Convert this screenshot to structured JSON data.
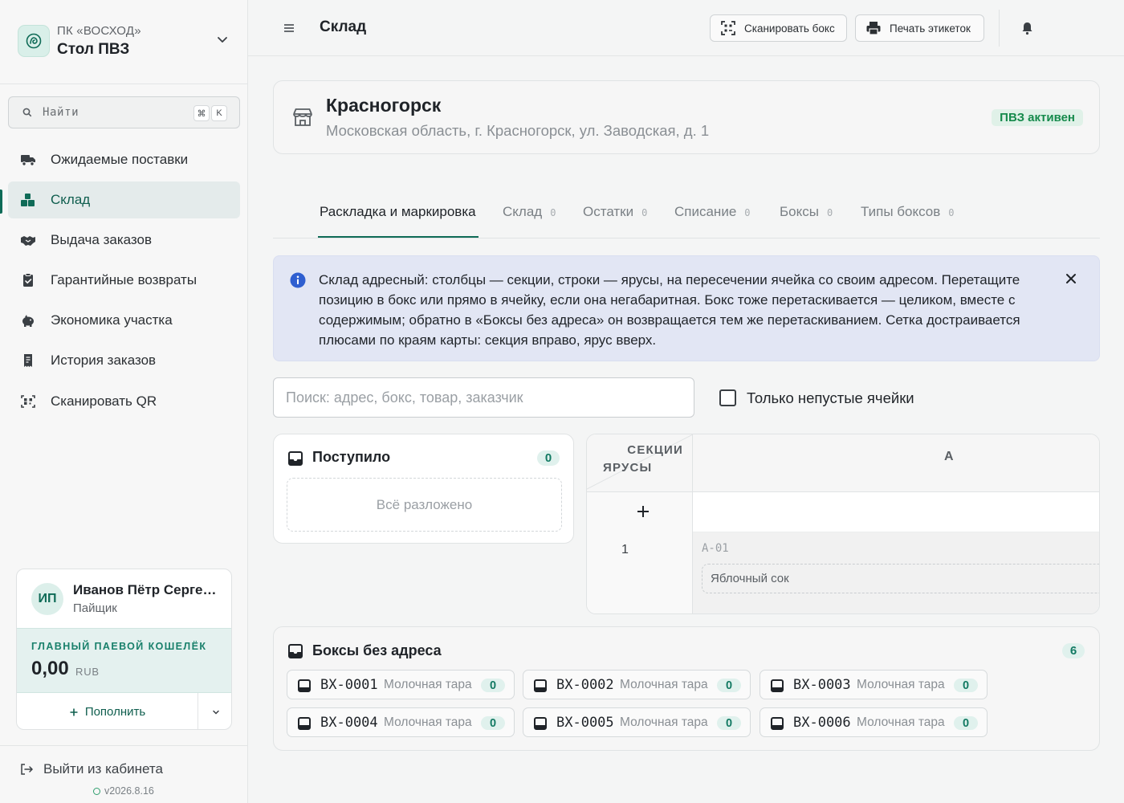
{
  "sidebar": {
    "org": "ПК «ВОСХОД»",
    "name": "Стол ПВЗ",
    "search": {
      "label": "Найти",
      "kbd": [
        "⌘",
        "K"
      ]
    },
    "items": [
      {
        "label": "Ожидаемые поставки",
        "icon": "truck-icon"
      },
      {
        "label": "Склад",
        "icon": "boxes-icon",
        "active": true
      },
      {
        "label": "Выдача заказов",
        "icon": "handshake-icon"
      },
      {
        "label": "Гарантийные возвраты",
        "icon": "clipboard-check-icon"
      },
      {
        "label": "Экономика участка",
        "icon": "piggy-bank-icon"
      },
      {
        "label": "История заказов",
        "icon": "receipt-icon"
      },
      {
        "label": "Сканировать QR",
        "icon": "qr-scan-icon"
      }
    ],
    "user": {
      "initials": "ИП",
      "name": "Иванов Пётр Сергеевич",
      "role": "Пайщик",
      "wallet_title": "ГЛАВНЫЙ ПАЕВОЙ КОШЕЛЁК",
      "wallet_amount": "0,00",
      "wallet_currency": "RUB",
      "topup_label": "Пополнить"
    },
    "logout": "Выйти из кабинета",
    "version": "v2026.8.16"
  },
  "header": {
    "title": "Склад",
    "scan_button": "Сканировать бокс",
    "print_button": "Печать этикеток"
  },
  "store": {
    "name": "Красногорск",
    "address": "Московская область, г. Красногорск, ул. Заводская, д. 1",
    "badge": "ПВЗ активен",
    "badge_color": "#168a4c"
  },
  "tabs": [
    {
      "label": "Раскладка и маркировка",
      "count": "",
      "active": true
    },
    {
      "label": "Склад",
      "count": "0"
    },
    {
      "label": "Остатки",
      "count": "0"
    },
    {
      "label": "Списание",
      "count": "0"
    },
    {
      "label": "Боксы",
      "count": "0"
    },
    {
      "label": "Типы боксов",
      "count": "0"
    }
  ],
  "info": {
    "text": "Склад адресный: столбцы — секции, строки — ярусы, на пересечении ячейка со своим адресом. Перетащите позицию в бокс или прямо в ячейку, если она негабаритная. Бокс тоже перетаскивается — целиком, вместе с содержимым; обратно в «Боксы без адреса» он возвращается тем же перетаскиванием. Сетка достраивается плюсами по краям карты: секция вправо, ярус вверх."
  },
  "filters": {
    "search_placeholder": "Поиск: адрес, бокс, товар, заказчик",
    "search_value": "",
    "nonempty_label": "Только непустые ячейки",
    "nonempty_checked": false
  },
  "incoming": {
    "title": "Поступило",
    "count": "0",
    "empty": "Всё разложено"
  },
  "grid": {
    "sections_label": "СЕКЦИИ",
    "tiers_label": "ЯРУСЫ",
    "columns": [
      "A"
    ],
    "rows": [
      "1"
    ],
    "cell": {
      "address": "A-01",
      "item": "Яблочный сок"
    }
  },
  "boxes": {
    "title": "Боксы без адреса",
    "count": "6",
    "items": [
      {
        "id": "BX-0001",
        "type": "Молочная тара",
        "count": "0"
      },
      {
        "id": "BX-0002",
        "type": "Молочная тара",
        "count": "0"
      },
      {
        "id": "BX-0003",
        "type": "Молочная тара",
        "count": "0"
      },
      {
        "id": "BX-0004",
        "type": "Молочная тара",
        "count": "0"
      },
      {
        "id": "BX-0005",
        "type": "Молочная тара",
        "count": "0"
      },
      {
        "id": "BX-0006",
        "type": "Молочная тара",
        "count": "0"
      }
    ]
  },
  "colors": {
    "accent": "#0f6b57",
    "info_bg": "#e2e6f4",
    "info_icon": "#2f5fd0"
  }
}
